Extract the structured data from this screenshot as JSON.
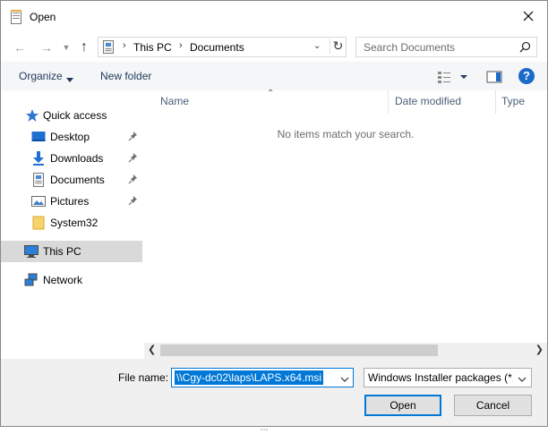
{
  "window": {
    "title": "Open",
    "icon": "document-icon"
  },
  "address": {
    "parts": [
      "This PC",
      "Documents"
    ],
    "search_placeholder": "Search Documents"
  },
  "toolbar": {
    "organize_label": "Organize",
    "new_folder_label": "New folder"
  },
  "nav_pane": {
    "items": [
      {
        "label": "Quick access",
        "icon": "star-icon"
      },
      {
        "label": "Desktop",
        "icon": "desktop-icon",
        "pinned": true
      },
      {
        "label": "Downloads",
        "icon": "download-arrow-icon",
        "pinned": true
      },
      {
        "label": "Documents",
        "icon": "document-icon",
        "pinned": true
      },
      {
        "label": "Pictures",
        "icon": "pictures-icon",
        "pinned": true
      },
      {
        "label": "System32",
        "icon": "folder-icon"
      },
      {
        "label": "This PC",
        "icon": "computer-icon",
        "selected": true
      },
      {
        "label": "Network",
        "icon": "network-icon"
      }
    ]
  },
  "file_list": {
    "columns": [
      "Name",
      "Date modified",
      "Type"
    ],
    "empty_message": "No items match your search."
  },
  "bottom": {
    "file_name_label": "File name:",
    "file_name_value": "\\\\Cgy-dc02\\laps\\LAPS.x64.msi",
    "file_type_value": "Windows Installer packages (*.msi)",
    "open_label": "Open",
    "cancel_label": "Cancel"
  },
  "colors": {
    "accent": "#0078d7",
    "selection": "#d9d9d9",
    "help": "#1b6ac9"
  }
}
